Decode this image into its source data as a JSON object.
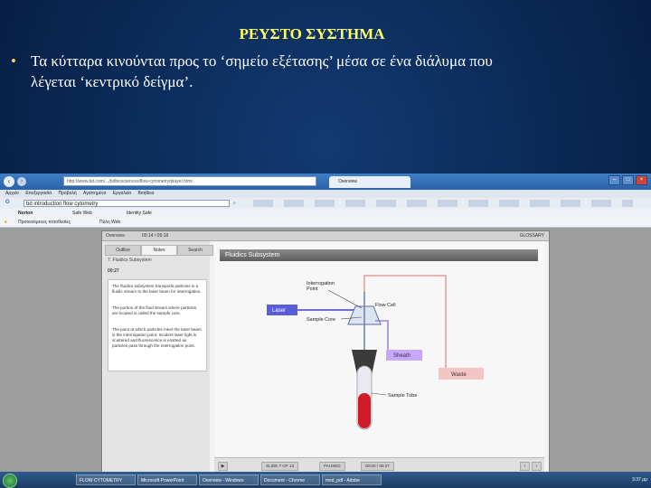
{
  "slide": {
    "title": "ΡΕΥΣΤΟ ΣΥΣΤΗΜΑ",
    "bullet_line1": "Τα κύτταρα κινούνται προς το ‘σημείο  εξέτασης’ μέσα σε ένα διάλυμα που",
    "bullet_line2": "λέγεται ‘κεντρικό δείγμα’."
  },
  "browser": {
    "address": "http://www.bd.com/.../bdbiosciences/flow-cytometry/player.html",
    "tab_label": "Overview",
    "menu": [
      "Αρχείο",
      "Επεξεργασία",
      "Προβολή",
      "Αγαπημένα",
      "Εργαλεία",
      "Βοήθεια"
    ],
    "google_search": "bd introduction flow cytometry",
    "toolbar2": [
      "Norton",
      "Safe Web",
      "Identity Safe"
    ],
    "favorites": [
      "Προτεινόμενες τοποθεσίες",
      "Πύλη Web"
    ]
  },
  "player": {
    "overview": "Overview",
    "time": "00:14 / 05:18",
    "glossary": "GLOSSARY",
    "tabs": [
      "Outline",
      "Notes",
      "Search"
    ],
    "lesson_title": "7. Fluidics Subsystem",
    "lesson_time": "00:27",
    "notes": [
      "The fluidics subsystem transports particles in a fluidic stream to the laser beam for interrogation.",
      "The portion of the fluid stream where particles are located is called the sample core.",
      "The point at which particles meet the laser beam is the interrogation point. Incident laser light is scattered and fluorescence is emitted as particles pass through the interrogation point."
    ],
    "banner": "Fluidics Subsystem",
    "labels": {
      "interrogation": "Interrogation",
      "point": "Point",
      "laser": "Laser",
      "flow_cell": "Flow Cell",
      "sample_core": "Sample Core",
      "sheath": "Sheath",
      "waste": "Waste",
      "sample_tube": "Sample Tube"
    },
    "bottom": {
      "slide": "SLIDE 7 OF 13",
      "status": "PAUSED",
      "time": "00:00 / 00:27"
    }
  },
  "taskbar": {
    "tasks": [
      "FLOW CYTOMETRY",
      "Microsoft PowerPoint",
      "Overview - Windows",
      "Document - Chrome",
      "msd_pdf - Adobe"
    ],
    "clock": "3:37 μμ"
  },
  "colors": {
    "title": "#ffff66",
    "laser": "#5a5ed6",
    "sheath": "#c8a8ff",
    "waste": "#f5c4c4",
    "blood": "#d01a2a"
  }
}
